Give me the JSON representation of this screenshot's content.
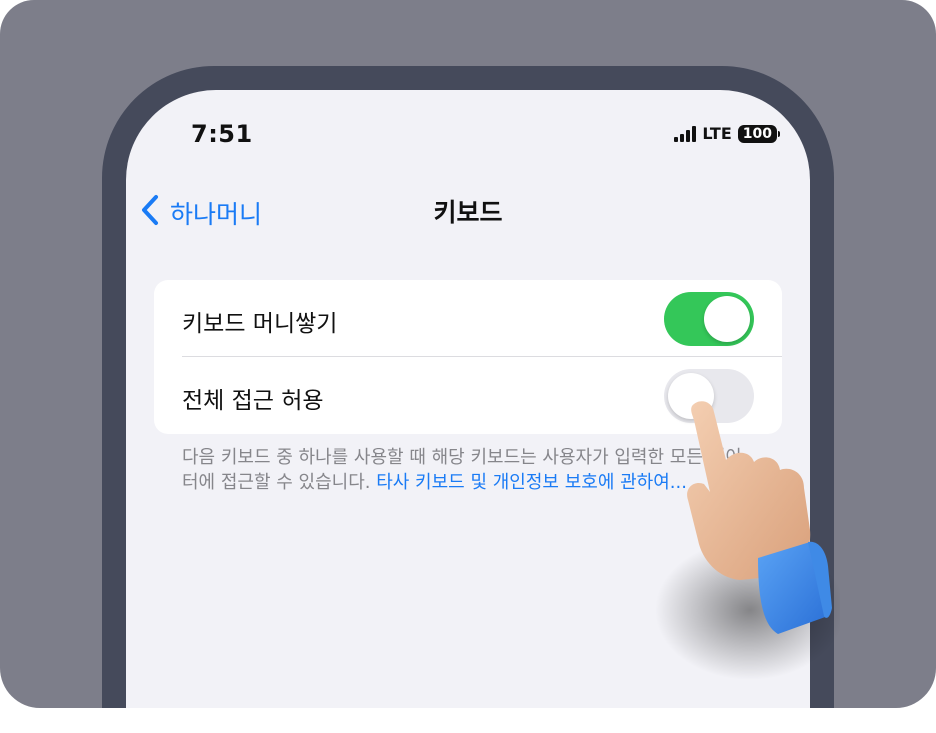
{
  "status_bar": {
    "time": "7:51",
    "network": "LTE",
    "battery": "100"
  },
  "nav": {
    "back_label": "하나머니",
    "title": "키보드"
  },
  "settings": {
    "rows": [
      {
        "label": "키보드 머니쌓기",
        "enabled": true
      },
      {
        "label": "전체 접근 허용",
        "enabled": false
      }
    ]
  },
  "footnote": {
    "text": "다음 키보드 중 하나를 사용할 때 해당 키보드는 사용자가 입력한 모든 데이터에 접근할 수 있습니다. ",
    "link": "타사 키보드 및 개인정보 보호에 관하여..."
  },
  "colors": {
    "accent": "#1a7bf5",
    "toggle_on": "#34c759",
    "toggle_off": "#e8e8ed",
    "background": "#7d7e8a",
    "phone_frame": "#454a5b",
    "screen_bg": "#f2f2f7"
  },
  "icons": {
    "back": "chevron-left-icon",
    "signal": "cellular-signal-icon",
    "battery": "battery-icon",
    "hand": "pointing-hand-icon"
  }
}
